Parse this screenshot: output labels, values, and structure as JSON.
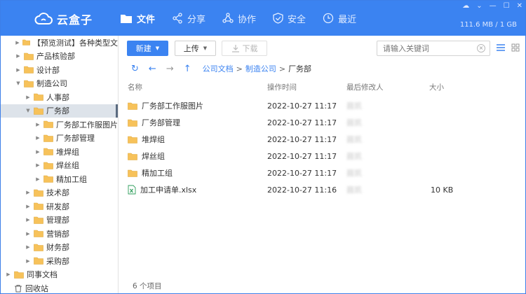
{
  "app": {
    "name": "云盒子"
  },
  "nav": [
    {
      "label": "文件",
      "icon": "folder-icon",
      "active": true
    },
    {
      "label": "分享",
      "icon": "share-icon",
      "active": false
    },
    {
      "label": "协作",
      "icon": "collab-icon",
      "active": false
    },
    {
      "label": "安全",
      "icon": "shield-icon",
      "active": false
    },
    {
      "label": "最近",
      "icon": "clock-icon",
      "active": false
    }
  ],
  "storage": "111.6 MB / 1 GB",
  "colors": {
    "primary": "#3b83f1",
    "folder": "#f7c25a",
    "selected_bg": "#dde3ea"
  },
  "sidebar": {
    "items": [
      {
        "label": "【预览测试】各种类型文",
        "level": 1,
        "caret": "right"
      },
      {
        "label": "产品核验部",
        "level": 1,
        "caret": "right"
      },
      {
        "label": "设计部",
        "level": 1,
        "caret": "right"
      },
      {
        "label": "制造公司",
        "level": 1,
        "caret": "down"
      },
      {
        "label": "人事部",
        "level": 2,
        "caret": "right"
      },
      {
        "label": "厂务部",
        "level": 2,
        "caret": "down",
        "selected": true
      },
      {
        "label": "厂务部工作服图片",
        "level": 3,
        "caret": "right"
      },
      {
        "label": "厂务部管理",
        "level": 3,
        "caret": "right"
      },
      {
        "label": "堆焊组",
        "level": 3,
        "caret": "right"
      },
      {
        "label": "焊丝组",
        "level": 3,
        "caret": "right"
      },
      {
        "label": "精加工组",
        "level": 3,
        "caret": "right"
      },
      {
        "label": "技术部",
        "level": 2,
        "caret": "right"
      },
      {
        "label": "研发部",
        "level": 2,
        "caret": "right"
      },
      {
        "label": "管理部",
        "level": 2,
        "caret": "right"
      },
      {
        "label": "营销部",
        "level": 2,
        "caret": "right"
      },
      {
        "label": "财务部",
        "level": 2,
        "caret": "right"
      },
      {
        "label": "采购部",
        "level": 2,
        "caret": "right"
      },
      {
        "label": "同事文档",
        "level": 0,
        "caret": "right"
      },
      {
        "label": "回收站",
        "level": 0,
        "caret": "none",
        "icon": "trash-icon"
      }
    ]
  },
  "toolbar": {
    "new_label": "新建",
    "upload_label": "上传",
    "download_label": "下载",
    "search_placeholder": "请输入关键词"
  },
  "breadcrumb": [
    "公司文档",
    "制造公司",
    "厂务部"
  ],
  "table": {
    "headers": [
      "名称",
      "操作时间",
      "最后修改人",
      "大小"
    ],
    "rows": [
      {
        "name": "厂务部工作服图片",
        "type": "folder",
        "time": "2022-10-27 11:17",
        "modifier": "聂凯",
        "size": ""
      },
      {
        "name": "厂务部管理",
        "type": "folder",
        "time": "2022-10-27 11:17",
        "modifier": "聂凯",
        "size": ""
      },
      {
        "name": "堆焊组",
        "type": "folder",
        "time": "2022-10-27 11:17",
        "modifier": "聂凯",
        "size": ""
      },
      {
        "name": "焊丝组",
        "type": "folder",
        "time": "2022-10-27 11:17",
        "modifier": "聂凯",
        "size": ""
      },
      {
        "name": "精加工组",
        "type": "folder",
        "time": "2022-10-27 11:17",
        "modifier": "聂凯",
        "size": ""
      },
      {
        "name": "加工申请单.xlsx",
        "type": "xlsx",
        "time": "2022-10-27 11:16",
        "modifier": "聂凯",
        "size": "10 KB"
      }
    ]
  },
  "footer": {
    "count": "6 个项目"
  }
}
